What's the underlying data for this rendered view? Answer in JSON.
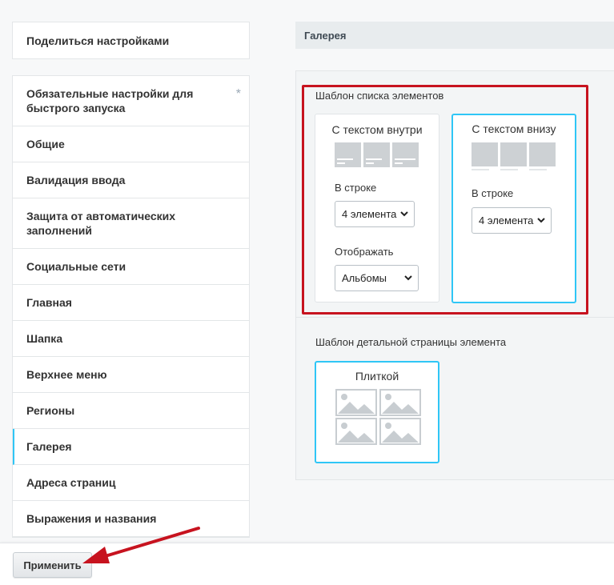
{
  "left": {
    "share_label": "Поделиться настройками",
    "menu": [
      {
        "label": "Обязательные настройки для быстрого запуска",
        "required_mark": "*"
      },
      {
        "label": "Общие"
      },
      {
        "label": "Валидация ввода"
      },
      {
        "label": "Защита от автоматических заполнений"
      },
      {
        "label": "Социальные сети"
      },
      {
        "label": "Главная"
      },
      {
        "label": "Шапка"
      },
      {
        "label": "Верхнее меню"
      },
      {
        "label": "Регионы"
      },
      {
        "label": "Галерея"
      },
      {
        "label": "Адреса страниц"
      },
      {
        "label": "Выражения и названия"
      }
    ],
    "active_item": "Галерея"
  },
  "section": {
    "title": "Галерея",
    "list_template": {
      "title": "Шаблон списка элементов",
      "options": [
        {
          "name": "С текстом внутри",
          "per_row_label": "В строке",
          "per_row_value": "4 элемента",
          "display_label": "Отображать",
          "display_value": "Альбомы"
        },
        {
          "name": "С текстом внизу",
          "per_row_label": "В строке",
          "per_row_value": "4 элемента",
          "selected": true
        }
      ]
    },
    "detail_template": {
      "title": "Шаблон детальной страницы элемента",
      "options": [
        {
          "name": "Плиткой",
          "selected": true
        }
      ]
    }
  },
  "footer": {
    "apply_label": "Применить"
  },
  "colors": {
    "accent": "#2fc6f6",
    "highlight": "#c7131f"
  }
}
